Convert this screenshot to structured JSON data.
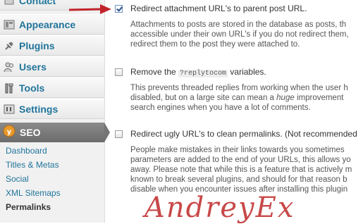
{
  "sidebar": {
    "contact_label": "Contact",
    "items": [
      {
        "label": "Appearance",
        "icon": "appearance-icon"
      },
      {
        "label": "Plugins",
        "icon": "plugins-icon"
      },
      {
        "label": "Users",
        "icon": "users-icon"
      },
      {
        "label": "Tools",
        "icon": "tools-icon"
      },
      {
        "label": "Settings",
        "icon": "settings-icon"
      }
    ],
    "seo": {
      "label": "SEO",
      "icon": "seo-icon"
    },
    "submenu": [
      {
        "label": "Dashboard"
      },
      {
        "label": "Titles & Metas"
      },
      {
        "label": "Social"
      },
      {
        "label": "XML Sitemaps"
      },
      {
        "label": "Permalinks",
        "current": true
      }
    ]
  },
  "options": [
    {
      "checked": true,
      "title": "Redirect attachment URL's to parent post URL.",
      "description": [
        "Attachments to posts are stored in the database as posts, th",
        "accessible under their own URL's if you do not redirect them,",
        "redirect them to the post they were attached to."
      ]
    },
    {
      "checked": false,
      "title_before": "Remove the",
      "title_code": "?replytocom",
      "title_after": "variables.",
      "description": [
        "This prevents threaded replies from working when the user h",
        "disabled, but on a large site can mean a",
        "search engines when you have a lot of comments."
      ],
      "description_emphasis": "huge",
      "description_after": "improvement"
    },
    {
      "checked": false,
      "title": "Redirect ugly URL's to clean permalinks. (Not recommended",
      "description": [
        "People make mistakes in their links towards you sometimes",
        "parameters are added to the end of your URLs, this allows yo",
        "away. Please note that while this is a feature that is actively m",
        "known to break several plugins, and should for that reason b",
        "disable when you encounter issues after installing this plugin"
      ]
    }
  ],
  "watermark": "AndreyEx",
  "colors": {
    "link": "#21759b",
    "arrow": "#c0242a",
    "seo_bg": "#747474",
    "watermark": "#be2828"
  }
}
